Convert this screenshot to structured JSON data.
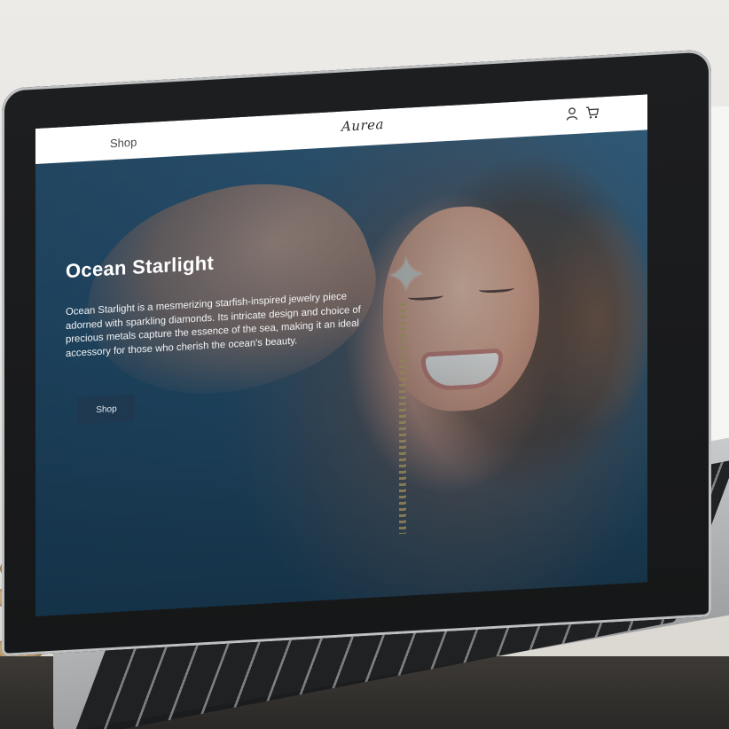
{
  "header": {
    "nav_shop_label": "Shop",
    "logo_text": "Aurea",
    "account_icon": "user-icon",
    "cart_icon": "cart-icon"
  },
  "hero": {
    "title": "Ocean Starlight",
    "description": "Ocean Starlight is a mesmerizing starfish-inspired jewelry piece adorned with sparkling diamonds. Its intricate design and choice of precious metals capture the essence of the sea, making it an ideal accessory for those who cherish the ocean's beauty.",
    "button_label": "Shop"
  },
  "colors": {
    "header_bg": "#ffffff",
    "button_bg": "#1e3850",
    "hero_tint": "#21465f"
  }
}
